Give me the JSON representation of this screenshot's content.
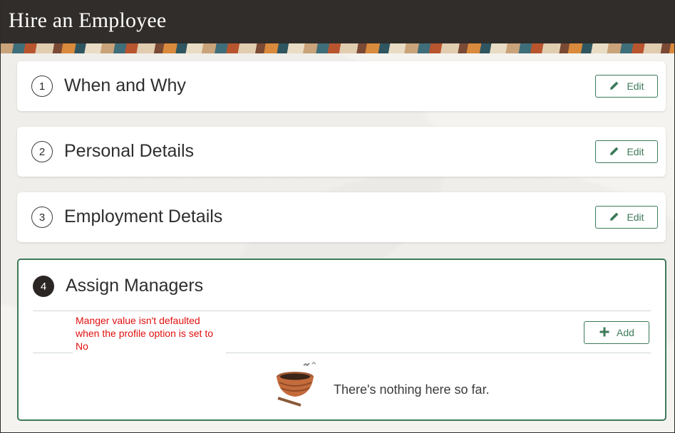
{
  "header": {
    "title": "Hire an Employee"
  },
  "steps": [
    {
      "number": "1",
      "title": "When and Why",
      "button": "Edit"
    },
    {
      "number": "2",
      "title": "Personal Details",
      "button": "Edit"
    },
    {
      "number": "3",
      "title": "Employment Details",
      "button": "Edit"
    }
  ],
  "active_step": {
    "number": "4",
    "title": "Assign Managers",
    "annotation": "Manger value isn't defaulted when the profile option is set to No",
    "add_button": "Add",
    "empty_message": "There's nothing here so far."
  },
  "colors": {
    "accent": "#3c7a59",
    "header_bg": "#312d2a",
    "annotation": "#e0100f"
  },
  "icons": {
    "edit": "pencil-icon",
    "add": "plus-icon",
    "empty": "nest-illustration"
  }
}
